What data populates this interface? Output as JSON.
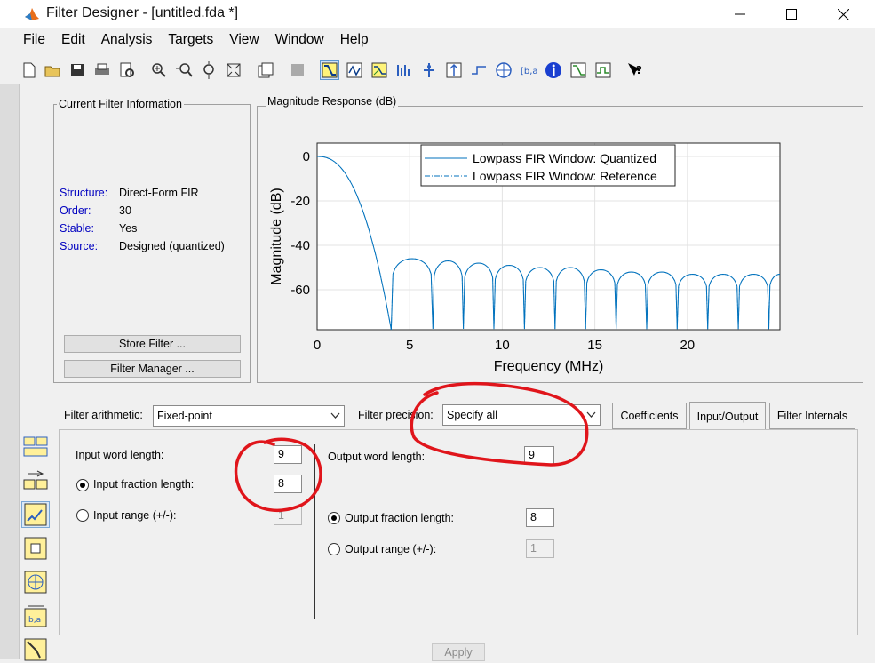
{
  "window": {
    "title": "Filter Designer -  [untitled.fda *]"
  },
  "menu": [
    "File",
    "Edit",
    "Analysis",
    "Targets",
    "View",
    "Window",
    "Help"
  ],
  "info": {
    "title": "Current Filter Information",
    "rows": [
      {
        "key": "Structure:",
        "value": "Direct-Form FIR"
      },
      {
        "key": "Order:",
        "value": "30"
      },
      {
        "key": "Stable:",
        "value": "Yes"
      },
      {
        "key": "Source:",
        "value": "Designed (quantized)"
      }
    ],
    "store_button": "Store Filter ...",
    "manager_button": "Filter Manager ..."
  },
  "plot_panel": {
    "title": "Magnitude Response (dB)"
  },
  "chart_data": {
    "type": "line",
    "xlabel": "Frequency (MHz)",
    "ylabel": "Magnitude (dB)",
    "xlim": [
      0,
      25
    ],
    "ylim": [
      -78,
      6
    ],
    "xticks": [
      0,
      5,
      10,
      15,
      20
    ],
    "yticks": [
      0,
      -20,
      -40,
      -60
    ],
    "grid": true,
    "legend_position": "top-right",
    "series": [
      {
        "name": "Lowpass FIR Window: Quantized",
        "style": "solid",
        "passband_edge_mhz": 4.0,
        "sidelobe_peaks_db": [
          -46,
          -47,
          -48,
          -49,
          -50,
          -50,
          -51,
          -52,
          -52,
          -53,
          -53
        ]
      },
      {
        "name": "Lowpass FIR Window: Reference",
        "style": "dashdot",
        "passband_edge_mhz": 4.0,
        "sidelobe_peaks_db": [
          -46,
          -47,
          -48,
          -49,
          -50,
          -50,
          -51,
          -52,
          -52,
          -53,
          -53
        ]
      }
    ],
    "nulls_mhz": [
      4.0,
      6.25,
      7.9,
      9.55,
      11.2,
      12.85,
      14.5,
      16.15,
      17.8,
      19.45,
      21.1,
      22.75,
      24.4
    ],
    "color": "#0072bd"
  },
  "settings": {
    "arithmetic_label": "Filter arithmetic:",
    "arithmetic_value": "Fixed-point",
    "precision_label": "Filter precision:",
    "precision_value": "Specify all",
    "tabs": [
      "Coefficients",
      "Input/Output",
      "Filter Internals"
    ],
    "active_tab": "Input/Output",
    "input_word_length_label": "Input word length:",
    "input_word_length": "9",
    "input_fraction_length_label": "Input fraction length:",
    "input_fraction_length": "8",
    "input_range_label": "Input range (+/-):",
    "input_range": "1",
    "output_word_length_label": "Output word length:",
    "output_word_length": "9",
    "output_fraction_length_label": "Output fraction length:",
    "output_fraction_length": "8",
    "output_range_label": "Output range (+/-):",
    "output_range": "1",
    "apply_button": "Apply"
  },
  "colors": {
    "accent": "#0072bd",
    "annotation": "#e0151b",
    "label_blue": "#0000c0"
  }
}
